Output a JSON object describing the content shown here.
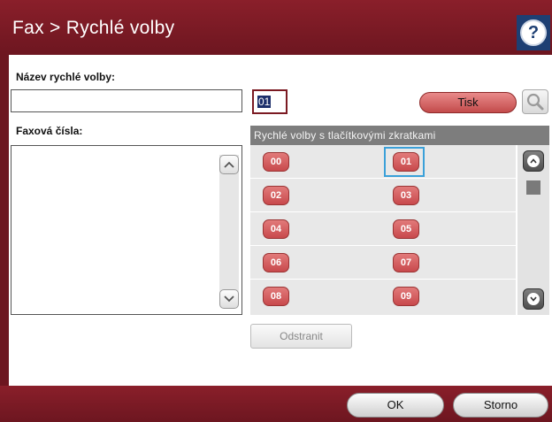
{
  "header": {
    "title": "Fax > Rychlé volby",
    "help_icon": "question-mark-icon",
    "help_symbol": "?"
  },
  "form": {
    "name_label": "Název rychlé volby:",
    "name_value": "",
    "speed_dial_number": "01",
    "print_button": "Tisk",
    "search_icon": "magnifier-icon",
    "fax_numbers_label": "Faxová čísla:",
    "up_arrow": "^",
    "down_arrow": "v"
  },
  "speed_dials": {
    "header": "Rychlé volby s tlačítkovými zkratkami",
    "selected": "01",
    "rows": [
      [
        "00",
        "01"
      ],
      [
        "02",
        "03"
      ],
      [
        "04",
        "05"
      ],
      [
        "06",
        "07"
      ],
      [
        "08",
        "09"
      ]
    ]
  },
  "actions": {
    "delete": "Odstranit",
    "ok": "OK",
    "cancel": "Storno"
  },
  "colors": {
    "titlebar": "#7a1a24",
    "accent": "#c8494c",
    "selection": "#3aa0d9",
    "help": "#1d3f73"
  }
}
